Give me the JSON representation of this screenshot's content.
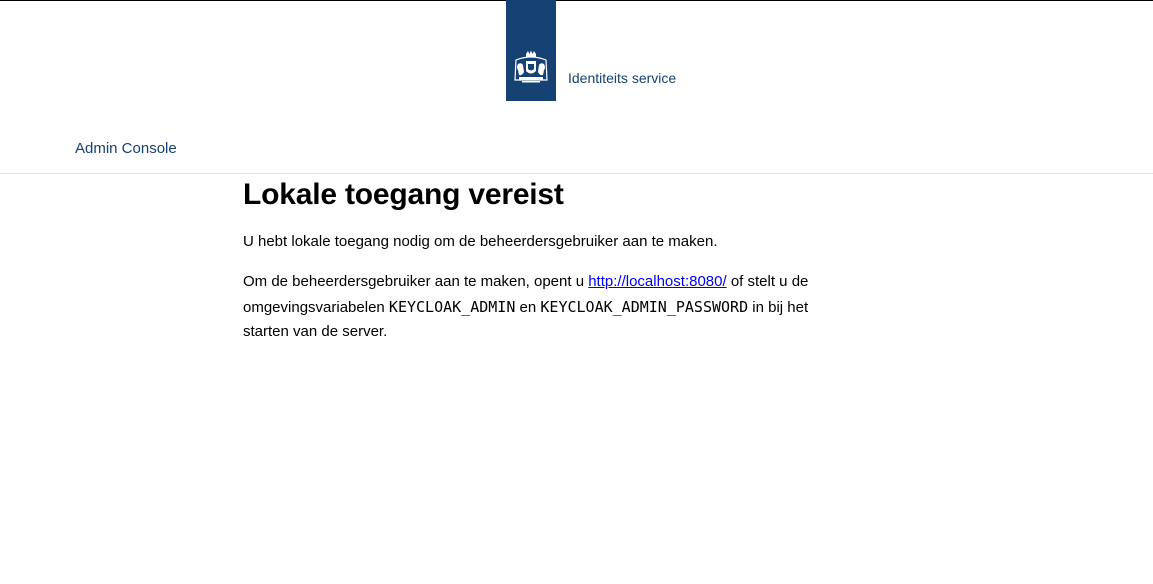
{
  "header": {
    "service_name": "Identiteits service",
    "brand_color": "#154273",
    "logo_icon": "royal-coat-of-arms-icon"
  },
  "nav": {
    "admin_console_label": "Admin Console"
  },
  "main": {
    "title": "Lokale toegang vereist",
    "paragraph1": "U hebt lokale toegang nodig om de beheerdersgebruiker aan te maken.",
    "paragraph2_before_link": "Om de beheerdersgebruiker aan te maken, opent u ",
    "link_text": "http://localhost:8080/",
    "paragraph2_after_link": " of stelt u de omgevingsvariabelen ",
    "env_var_1": "KEYCLOAK_ADMIN",
    "paragraph2_between_vars": " en ",
    "env_var_2": "KEYCLOAK_ADMIN_PASSWORD",
    "paragraph2_end": " in bij het starten van de server."
  }
}
